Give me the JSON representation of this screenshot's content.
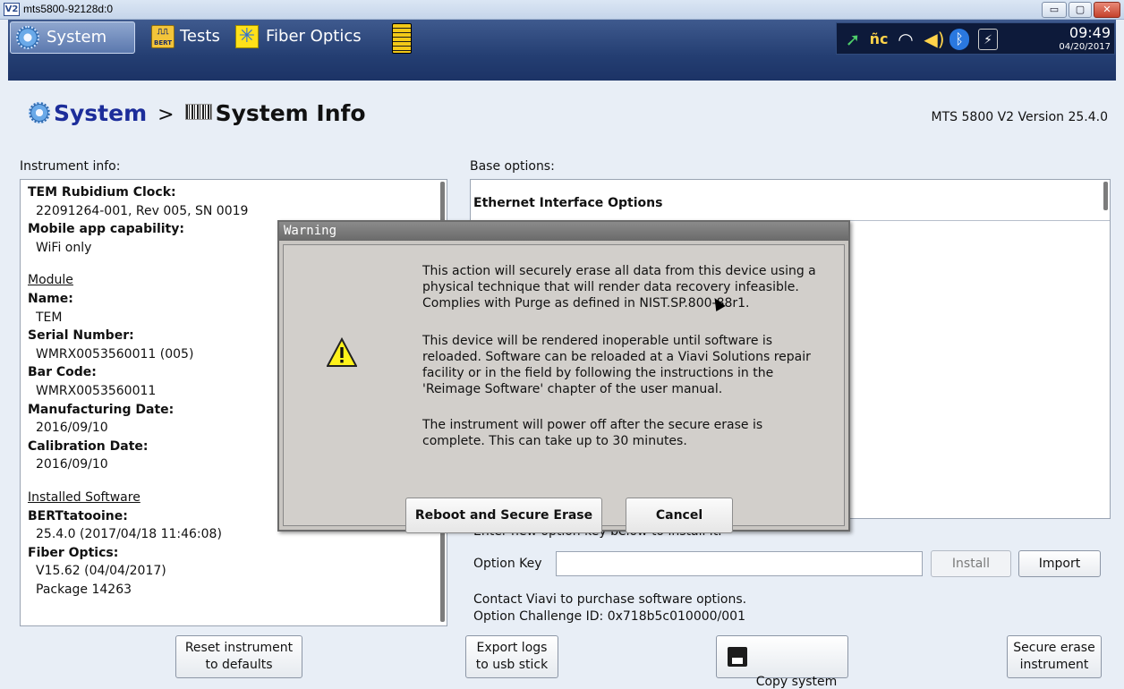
{
  "window": {
    "title": "mts5800-92128d:0",
    "logo": "V2",
    "min": "▭",
    "max": "▢",
    "close": "✕"
  },
  "appbar": {
    "tabs": [
      {
        "label": "System",
        "icon": "gear-icon"
      },
      {
        "label": "Tests",
        "icon": "bert-icon",
        "icon_text": "BERT"
      },
      {
        "label": "Fiber Optics",
        "icon": "fiber-optics-icon"
      }
    ],
    "status": {
      "time": "09:49",
      "date": "04/20/2017"
    }
  },
  "breadcrumb": {
    "root": "System",
    "sep": ">",
    "current": "System Info"
  },
  "version": "MTS 5800 V2 Version 25.4.0",
  "instrument": {
    "label": "Instrument info:",
    "rubidium_h": "TEM Rubidium Clock:",
    "rubidium_v": "22091264-001, Rev 005, SN 0019",
    "mobile_h": "Mobile app capability:",
    "mobile_v": "WiFi only",
    "module_sec": "Module",
    "name_h": "Name:",
    "name_v": "TEM",
    "serial_h": "Serial Number:",
    "serial_v": "WMRX0053560011 (005)",
    "barcode_h": "Bar Code:",
    "barcode_v": "WMRX0053560011",
    "mfg_h": "Manufacturing Date:",
    "mfg_v": "2016/09/10",
    "cal_h": "Calibration Date:",
    "cal_v": "2016/09/10",
    "sw_sec": "Installed Software",
    "bert_h": "BERTtatooine:",
    "bert_v": "25.4.0 (2017/04/18 11:46:08)",
    "fiber_h": "Fiber Optics:",
    "fiber_v1": "V15.62 (04/04/2017)",
    "fiber_v2": "Package 14263"
  },
  "base": {
    "label": "Base options:",
    "head": "Ethernet Interface Options",
    "enter_key": "Enter new option key below to install it.",
    "option_key_label": "Option Key",
    "install": "Install",
    "import": "Import",
    "contact": "Contact Viavi to purchase software options.",
    "challenge": "Option Challenge ID: 0x718b5c010000/001"
  },
  "bottom": {
    "reset": "Reset instrument\nto defaults",
    "export": "Export logs\nto usb stick",
    "copy": "Copy system\ninfo to file",
    "erase": "Secure erase\ninstrument"
  },
  "dialog": {
    "title": "Warning",
    "p1": "This action will securely erase all data from this device using a\nphysical technique that will render data recovery infeasible.\nComplies with Purge as defined in NIST.SP.800-88r1.",
    "p2": "This device will be rendered inoperable until software is\nreloaded. Software can be reloaded at a Viavi Solutions repair\nfacility or in the field by following the instructions in the\n'Reimage Software' chapter of the user manual.",
    "p3": "The instrument will power off after the secure erase is\ncomplete. This can take up to 30 minutes.",
    "reboot": "Reboot and Secure Erase",
    "cancel": "Cancel"
  }
}
